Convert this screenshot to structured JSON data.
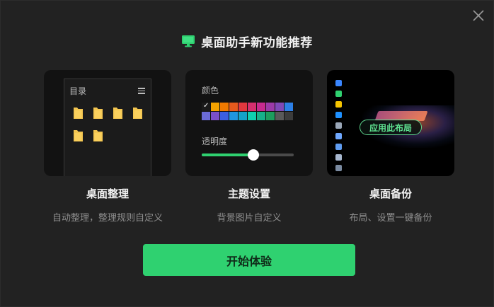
{
  "header": {
    "title": "桌面助手新功能推荐",
    "logo_icon": "monitor-icon",
    "accent": "#2fd170"
  },
  "close_icon": "close-icon",
  "cards": [
    {
      "title": "桌面整理",
      "desc": "自动整理，整理规则自定义",
      "preview": {
        "panel_title": "目录",
        "menu_icon": "hamburger-menu-icon",
        "folder_icon": "folder-icon",
        "folder_color": "#f3c550"
      }
    },
    {
      "title": "主题设置",
      "desc": "背景图片自定义",
      "preview": {
        "color_label": "颜色",
        "opacity_label": "透明度",
        "opacity_value": 0.56,
        "swatch_colors": [
          "#1a1a1a",
          "#f5a300",
          "#f07a00",
          "#e55a1d",
          "#e0383e",
          "#d52f6e",
          "#c62a8e",
          "#9b3aa8",
          "#7f49b8",
          "#2c7fe6",
          "#6b6bd6",
          "#7b4fc8",
          "#3b5fe0",
          "#1f95e0",
          "#13a3c8",
          "#0fd0b0",
          "#16b08a",
          "#1d9d5e",
          "#5a5a5a",
          "#3c3c3c"
        ],
        "selected_swatch": 0,
        "check_glyph": "✓"
      }
    },
    {
      "title": "桌面备份",
      "desc": "布局、设置一键备份",
      "preview": {
        "apply_label": "应用此布局"
      }
    }
  ],
  "start_button": {
    "label": "开始体验"
  }
}
